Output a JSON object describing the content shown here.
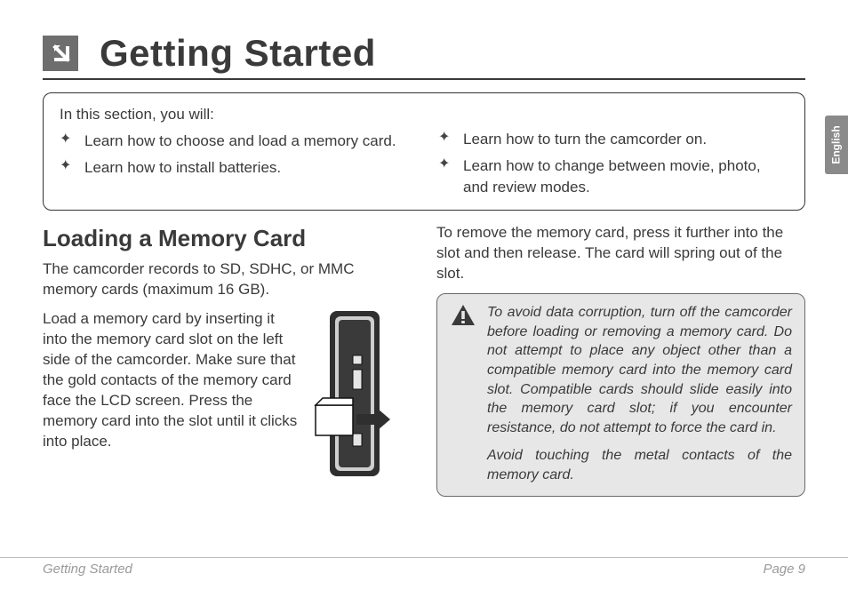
{
  "title": "Getting Started",
  "language_tab": "English",
  "section_box": {
    "intro": "In this section, you will:",
    "left": [
      "Learn how to choose and load a memory card.",
      "Learn how to install batteries."
    ],
    "right": [
      "Learn how to turn the camcorder on.",
      "Learn how to change between movie, photo, and review modes."
    ]
  },
  "subheading": "Loading a Memory Card",
  "intro_p": "The camcorder records to SD, SDHC, or MMC memory cards (maximum 16 GB).",
  "load_p": "Load a memory card by inserting it into the memory card slot on the left side of the camcorder. Make sure that the gold contacts of the memory card face the LCD screen. Press the memory card into the slot until it clicks into place.",
  "remove_p": "To remove the memory card, press it further into the slot and then release. The card will spring out of the slot.",
  "warning": {
    "p1": "To avoid data corruption, turn off the camcorder before loading or removing a memory card. Do not attempt to place any object other than a compatible memory card into the memory card slot. Compatible cards should slide easily into the memory card slot; if you encounter resistance, do not attempt to force the card in.",
    "p2": "Avoid touching the metal contacts of the memory card."
  },
  "footer": {
    "left": "Getting Started",
    "right": "Page 9"
  }
}
